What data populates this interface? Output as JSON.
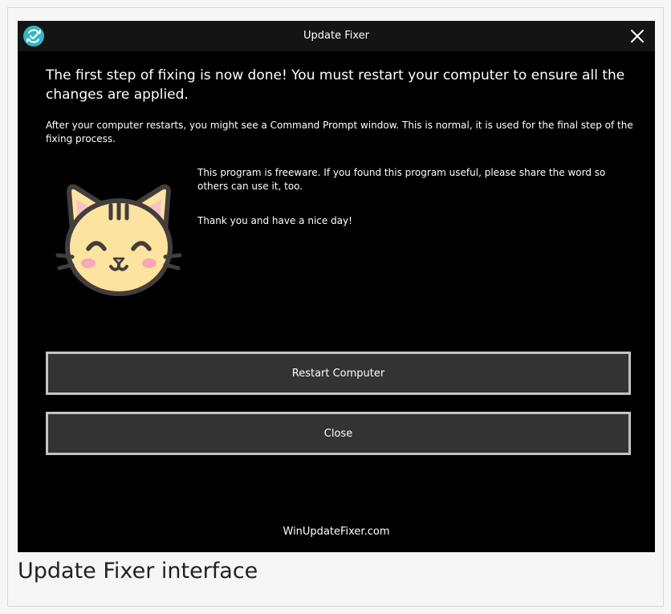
{
  "window": {
    "title": "Update Fixer",
    "app_icon": "refresh-check-icon",
    "close_icon": "close-icon"
  },
  "content": {
    "headline": "The first step of fixing is now done! You must restart your computer to ensure all the changes are applied.",
    "restart_note": "After your computer restarts, you might see a Command Prompt window. This is normal, it is used for the final step of the fixing process.",
    "freeware_note": "This program is freeware. If you found this program useful, please share the word so others can use it, too.",
    "thanks_note": "Thank you and have a nice day!",
    "mascot_icon": "smiling-cat-icon"
  },
  "buttons": {
    "restart_label": "Restart Computer",
    "close_label": "Close"
  },
  "footer": {
    "link_text": "WinUpdateFixer.com"
  },
  "caption": {
    "text": "Update Fixer interface"
  },
  "colors": {
    "window_bg": "#000000",
    "titlebar_bg": "#141414",
    "button_bg": "#333333",
    "button_border": "#c4c4c4",
    "icon_accent": "#36b6c6",
    "cat_fur": "#fde3a0",
    "cat_outline": "#433e3c",
    "cat_blush": "#f7a8b5"
  }
}
